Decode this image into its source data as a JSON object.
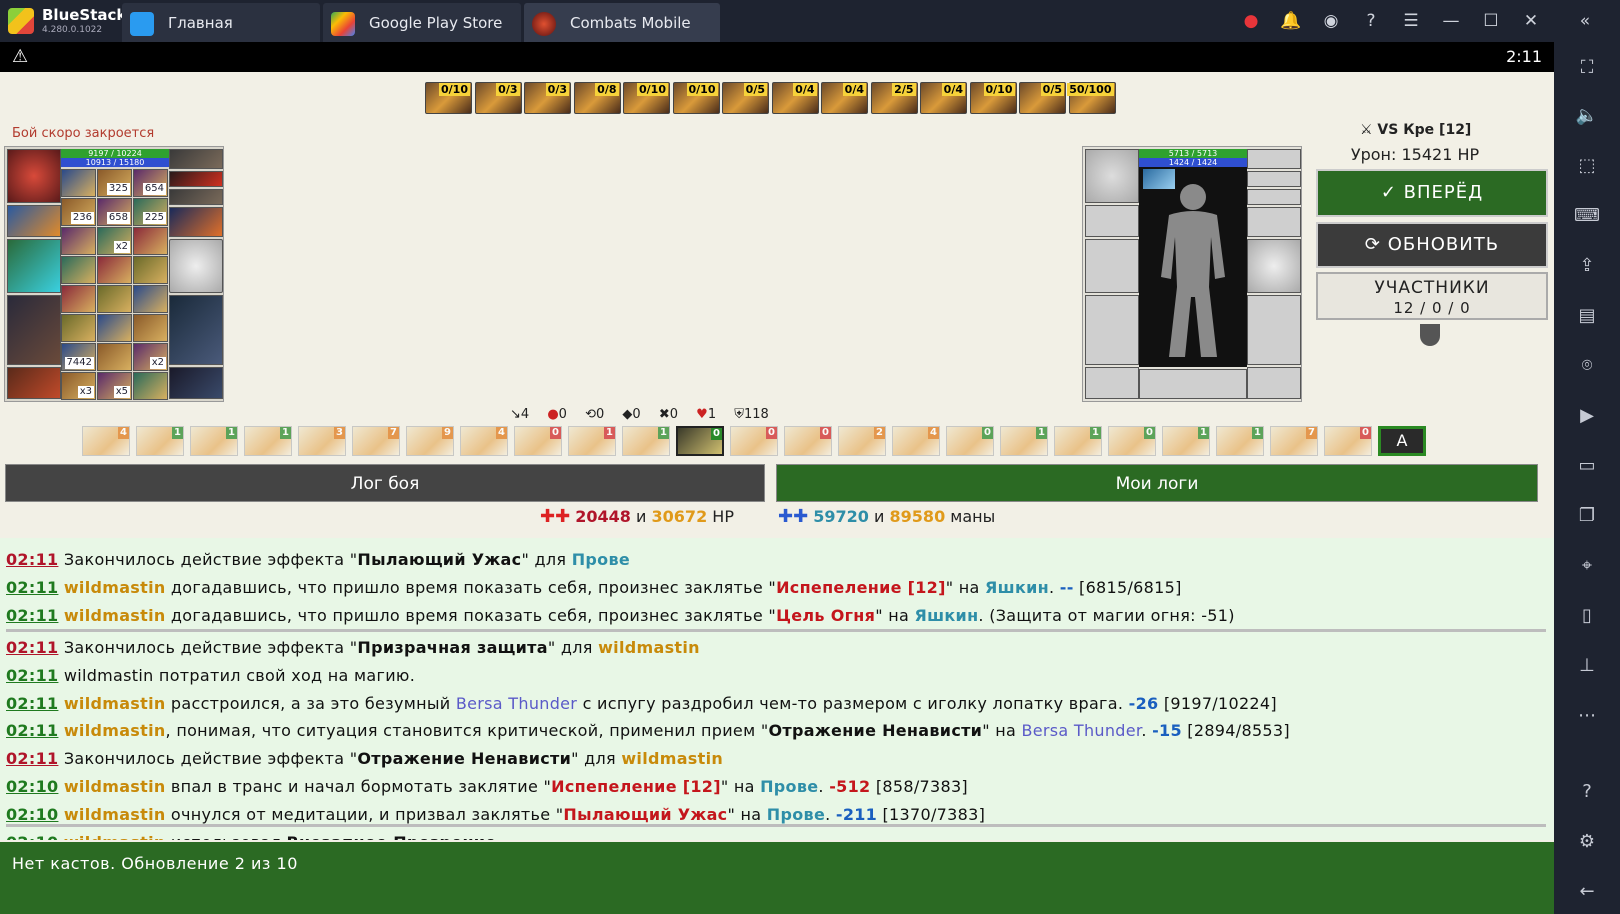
{
  "app": {
    "name": "BlueStacks",
    "version": "4.280.0.1022"
  },
  "tabs": [
    {
      "label": "Главная"
    },
    {
      "label": "Google Play Store"
    },
    {
      "label": "Combats Mobile"
    }
  ],
  "status": {
    "time": "2:11"
  },
  "buffs": [
    "0/10",
    "0/3",
    "0/3",
    "0/8",
    "0/10",
    "0/10",
    "0/5",
    "0/4",
    "0/4",
    "2/5",
    "0/4",
    "0/10",
    "0/5",
    "50/100"
  ],
  "fight": {
    "closing_notice": "Бой скоро закроется"
  },
  "player": {
    "hp": "9197 / 10224",
    "mana": "10913 / 15180",
    "counts": [
      "325",
      "654",
      "236",
      "658",
      "225",
      "x2",
      "7442",
      "x2",
      "x3",
      "x5"
    ]
  },
  "opponent": {
    "hp": "5713 / 5713",
    "mana": "1424 / 1424",
    "vs_label": "Кре [12]",
    "damage": "Урон: 15421 HP"
  },
  "actions": {
    "forward": "✓ ВПЕРЁД",
    "refresh": "⟳ ОБНОВИТЬ",
    "participants": "УЧАСТНИКИ",
    "participants_count": "12 / 0 / 0"
  },
  "stats": [
    "4",
    "0",
    "0",
    "0",
    "0",
    "1",
    "118"
  ],
  "abilities": [
    "4",
    "1",
    "1",
    "1",
    "3",
    "7",
    "9",
    "4",
    "0",
    "1",
    "1",
    "0",
    "0",
    "0",
    "2",
    "4",
    "0",
    "1",
    "1",
    "0",
    "1",
    "1",
    "7",
    "0"
  ],
  "ability_last": "A",
  "log_tabs": {
    "battle": "Лог боя",
    "mine": "Мои логи"
  },
  "summary": {
    "hp_a": "20448",
    "and1": "и",
    "hp_b": "30672",
    "hp_unit": "HP",
    "mana_a": "59720",
    "and2": "и",
    "mana_b": "89580",
    "mana_unit": "маны"
  },
  "log": [
    {
      "time": "02:11",
      "tc": "r",
      "parts": [
        [
          "",
          "Закончилось действие эффекта \""
        ],
        [
          "bo",
          "Пылающий Ужас"
        ],
        [
          "",
          "\" для "
        ],
        [
          "p-bl",
          "Прове"
        ]
      ]
    },
    {
      "time": "02:11",
      "tc": "g",
      "parts": [
        [
          "p-or",
          "wildmastin"
        ],
        [
          "",
          " догадавшись, что пришло время показать себя, произнес заклятье \""
        ],
        [
          "sp",
          "Испепеление [12]"
        ],
        [
          "",
          "\" на "
        ],
        [
          "p-bl",
          "Яшкин"
        ],
        [
          "",
          ". "
        ],
        [
          "nb",
          "--"
        ],
        [
          "",
          " [6815/6815]"
        ]
      ]
    },
    {
      "time": "02:11",
      "tc": "g",
      "parts": [
        [
          "p-or",
          "wildmastin"
        ],
        [
          "",
          " догадавшись, что пришло время показать себя, произнес заклятье \""
        ],
        [
          "sp",
          "Цель Огня"
        ],
        [
          "",
          "\" на "
        ],
        [
          "p-bl",
          "Яшкин"
        ],
        [
          "",
          ". (Защита от магии огня: -51)"
        ]
      ]
    },
    {
      "time": "02:11",
      "tc": "r",
      "parts": [
        [
          "",
          "Закончилось действие эффекта \""
        ],
        [
          "bo",
          "Призрачная защита"
        ],
        [
          "",
          "\" для "
        ],
        [
          "p-or",
          "wildmastin"
        ]
      ]
    },
    {
      "time": "02:11",
      "tc": "g",
      "parts": [
        [
          "",
          "wildmastin потратил свой ход на магию."
        ]
      ]
    },
    {
      "time": "02:11",
      "tc": "g",
      "parts": [
        [
          "p-or",
          "wildmastin"
        ],
        [
          "",
          " расстроился, а за это безумный "
        ],
        [
          "p-vi",
          "Bersa Thunder"
        ],
        [
          "",
          " с испугу раздробил чем-то размером с иголку лопатку врага. "
        ],
        [
          "nb",
          "-26"
        ],
        [
          "",
          " [9197/10224]"
        ]
      ]
    },
    {
      "time": "02:11",
      "tc": "g",
      "parts": [
        [
          "p-or",
          "wildmastin"
        ],
        [
          "",
          ", понимая, что ситуация становится критической, применил прием \""
        ],
        [
          "bo",
          "Отражение Ненависти"
        ],
        [
          "",
          "\" на "
        ],
        [
          "p-vi",
          "Bersa Thunder"
        ],
        [
          "",
          ". "
        ],
        [
          "nb",
          "-15"
        ],
        [
          "",
          " [2894/8553]"
        ]
      ]
    },
    {
      "time": "02:11",
      "tc": "r",
      "parts": [
        [
          "",
          "Закончилось действие эффекта \""
        ],
        [
          "bo",
          "Отражение Ненависти"
        ],
        [
          "",
          "\" для "
        ],
        [
          "p-or",
          "wildmastin"
        ]
      ]
    },
    {
      "time": "02:10",
      "tc": "g",
      "parts": [
        [
          "p-or",
          "wildmastin"
        ],
        [
          "",
          " впал в транс и начал бормотать заклятие \""
        ],
        [
          "sp",
          "Испепеление [12]"
        ],
        [
          "",
          "\" на "
        ],
        [
          "p-bl",
          "Прове"
        ],
        [
          "",
          ". "
        ],
        [
          "sp",
          "-512"
        ],
        [
          "",
          " [858/7383]"
        ]
      ]
    },
    {
      "time": "02:10",
      "tc": "g",
      "parts": [
        [
          "p-or",
          "wildmastin"
        ],
        [
          "",
          " очнулся от медитации, и призвал заклятье \""
        ],
        [
          "sp",
          "Пылающий Ужас"
        ],
        [
          "",
          "\" на "
        ],
        [
          "p-bl",
          "Прове"
        ],
        [
          "",
          ". "
        ],
        [
          "nb",
          "-211"
        ],
        [
          "",
          " [1370/7383]"
        ]
      ]
    },
    {
      "time": "02:10",
      "tc": "g",
      "parts": [
        [
          "p-or",
          "wildmastin"
        ],
        [
          "",
          " использовал "
        ],
        [
          "bo",
          "Внезапное Прозрение"
        ]
      ]
    }
  ],
  "bottom": {
    "text": "Нет кастов. Обновление 2 из 10"
  },
  "colors": {
    "green": "#2b6a23",
    "dark": "#3b3b3b",
    "accent": "#b0152a"
  }
}
